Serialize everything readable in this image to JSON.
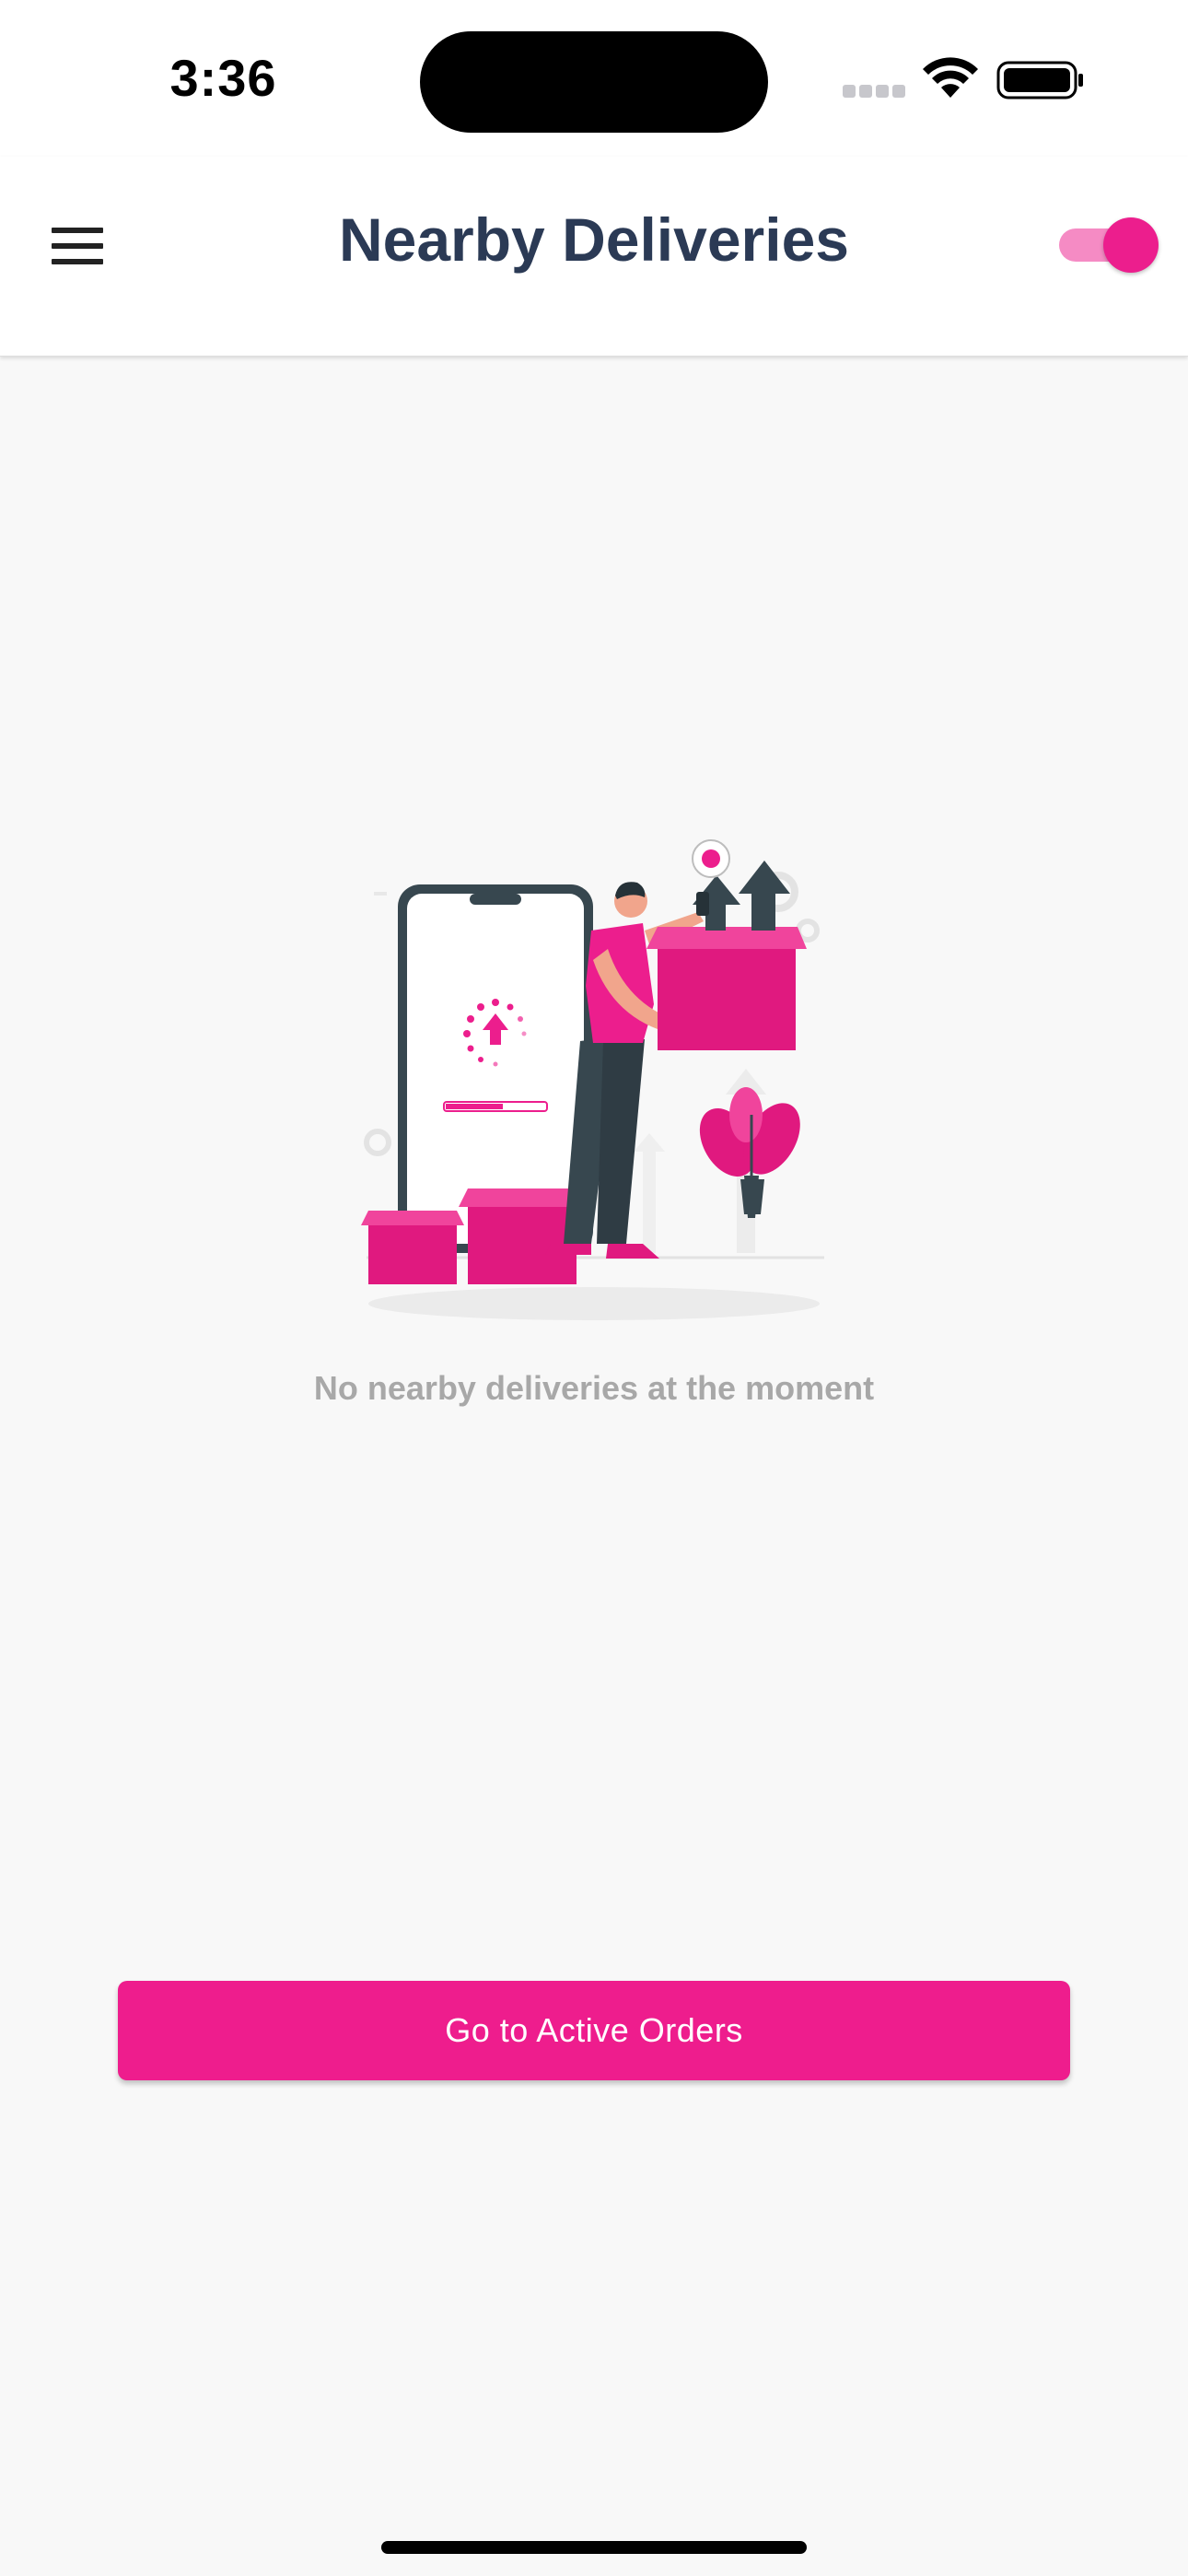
{
  "status_bar": {
    "time": "3:36",
    "icons": [
      "signal-icon",
      "wifi-icon",
      "battery-icon"
    ]
  },
  "app_bar": {
    "menu_icon": "hamburger-menu-icon",
    "title": "Nearby Deliveries",
    "toggle_on": true
  },
  "empty_state": {
    "illustration": "delivery-man-with-boxes-illustration",
    "message": "No nearby deliveries at the moment"
  },
  "actions": {
    "active_orders_label": "Go to Active Orders"
  },
  "colors": {
    "accent": "#ee1d8d",
    "accent_light": "#f58bc4",
    "title": "#2b3a55",
    "muted_text": "#a8a8a8",
    "background": "#f8f8f8",
    "illustration_dark": "#37474f"
  }
}
